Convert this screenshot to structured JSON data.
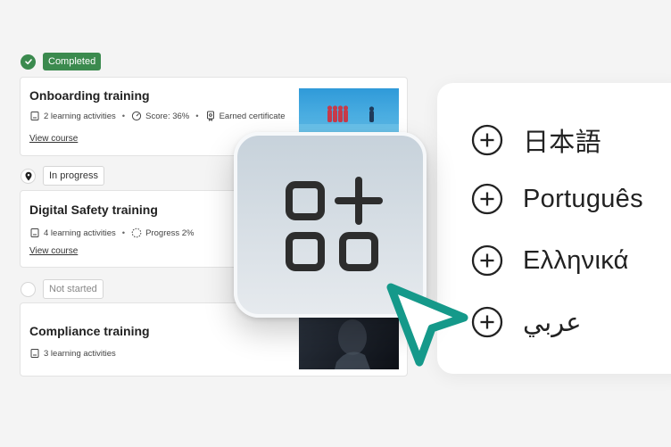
{
  "courses": [
    {
      "status": "Completed",
      "title": "Onboarding training",
      "activities": "2 learning activities",
      "score": "Score: 36%",
      "certificate": "Earned certificate",
      "link": "View course"
    },
    {
      "status": "In progress",
      "title": "Digital Safety training",
      "activities": "4 learning activities",
      "progress": "Progress 2%",
      "link": "View course"
    },
    {
      "status": "Not started",
      "title": "Compliance training",
      "activities": "3 learning activities"
    }
  ],
  "languages": [
    "日本語",
    "Português",
    "Ελληνικά",
    "عربي"
  ],
  "colors": {
    "completed": "#3b8a4e",
    "cursor": "#15998a",
    "tile_top": "#c7d2db",
    "tile_bottom": "#e6eaee"
  },
  "icons": {
    "tile": "apps-plus-icon",
    "language_action": "plus-circle-icon",
    "pointer": "cursor-arrow-icon"
  }
}
